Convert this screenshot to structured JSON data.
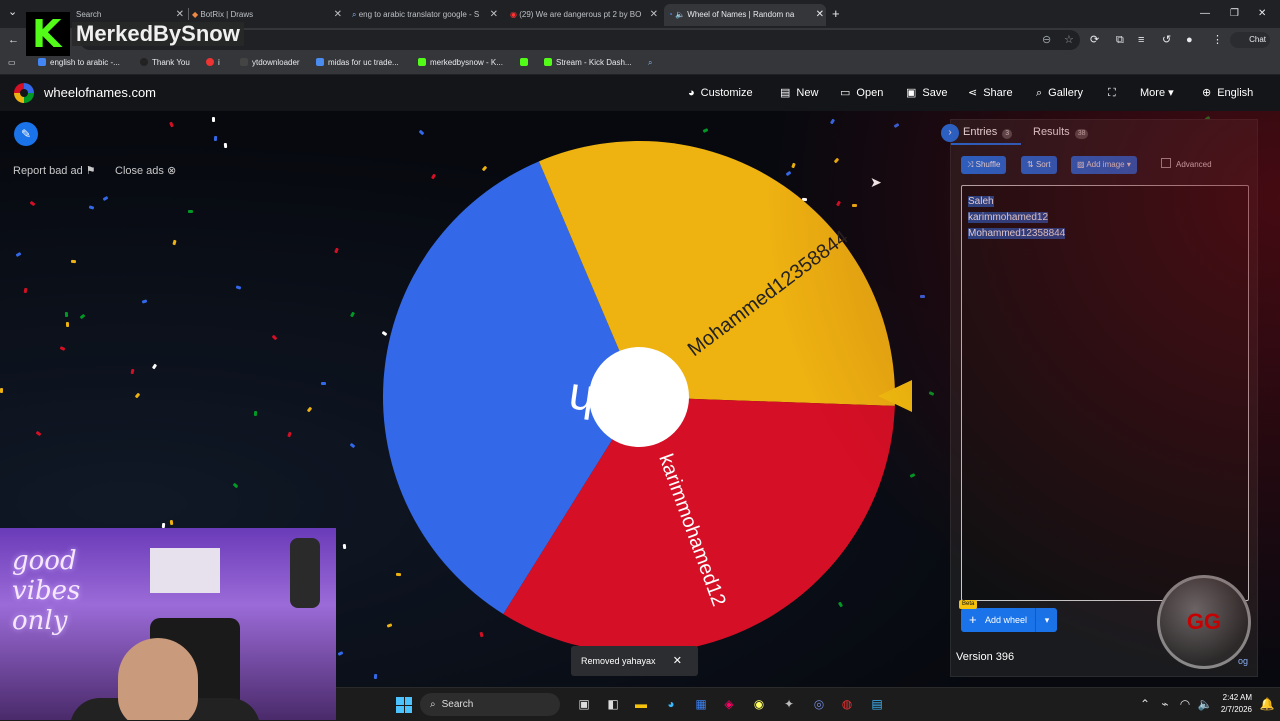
{
  "browser": {
    "tabs": [
      {
        "label": "Search",
        "close": "✕"
      },
      {
        "label": "BotRix | Draws",
        "close": "✕"
      },
      {
        "label": "eng to arabic translator google - S",
        "close": "✕"
      },
      {
        "label": "(29) We are dangerous pt 2 by BO",
        "close": "✕"
      },
      {
        "label": "Wheel of Names | Random na",
        "close": "✕"
      }
    ],
    "new_tab": "+",
    "chat_label": "Chat",
    "bookmarks": [
      "english to arabic -...",
      "Thank You",
      "i",
      "ytdownloader",
      "midas for uc trade...",
      "merkedbysnow - K...",
      "",
      "Stream - Kick Dash..."
    ]
  },
  "overlay": {
    "channel_name": "MerkedBySnow",
    "logo_letter": "K"
  },
  "app": {
    "brand": "wheelofnames.com",
    "menu": [
      {
        "label": "Customize",
        "icon": "palette-icon"
      },
      {
        "label": "New",
        "icon": "file-icon"
      },
      {
        "label": "Open",
        "icon": "folder-icon"
      },
      {
        "label": "Save",
        "icon": "save-icon"
      },
      {
        "label": "Share",
        "icon": "share-icon"
      },
      {
        "label": "Gallery",
        "icon": "search-icon"
      },
      {
        "label": "",
        "icon": "fullscreen-icon"
      },
      {
        "label": "More",
        "icon": "chevron-down-icon"
      },
      {
        "label": "English",
        "icon": "globe-icon"
      }
    ],
    "report_bad_ad": "Report bad ad",
    "close_ads": "Close ads"
  },
  "wheel": {
    "entries": [
      "Saleh",
      "Mohammed12358844",
      "karimmohamed12"
    ],
    "colors": {
      "Saleh": "#3369e8",
      "Mohammed12358844": "#eeb211",
      "karimmohamed12": "#d50f25"
    },
    "pointer_color": "#f4c20d"
  },
  "panel": {
    "tab_entries": "Entries",
    "entries_count": "3",
    "tab_results": "Results",
    "results_count": "38",
    "shuffle": "Shuffle",
    "sort": "Sort",
    "add_image": "Add image",
    "advanced": "Advanced",
    "text_entries": [
      "Saleh",
      "karimmohamed12",
      "Mohammed12358844"
    ],
    "beta_badge": "Beta",
    "add_wheel": "Add wheel",
    "version": "Version 396",
    "changelog_fragment": "og",
    "team_logo": "GG"
  },
  "toast": {
    "message": "Removed yahayax"
  },
  "webcam": {
    "neon_text": "good vibes only"
  },
  "taskbar": {
    "search": "Search",
    "time": "2:42 AM",
    "date": "2/7/2026"
  }
}
